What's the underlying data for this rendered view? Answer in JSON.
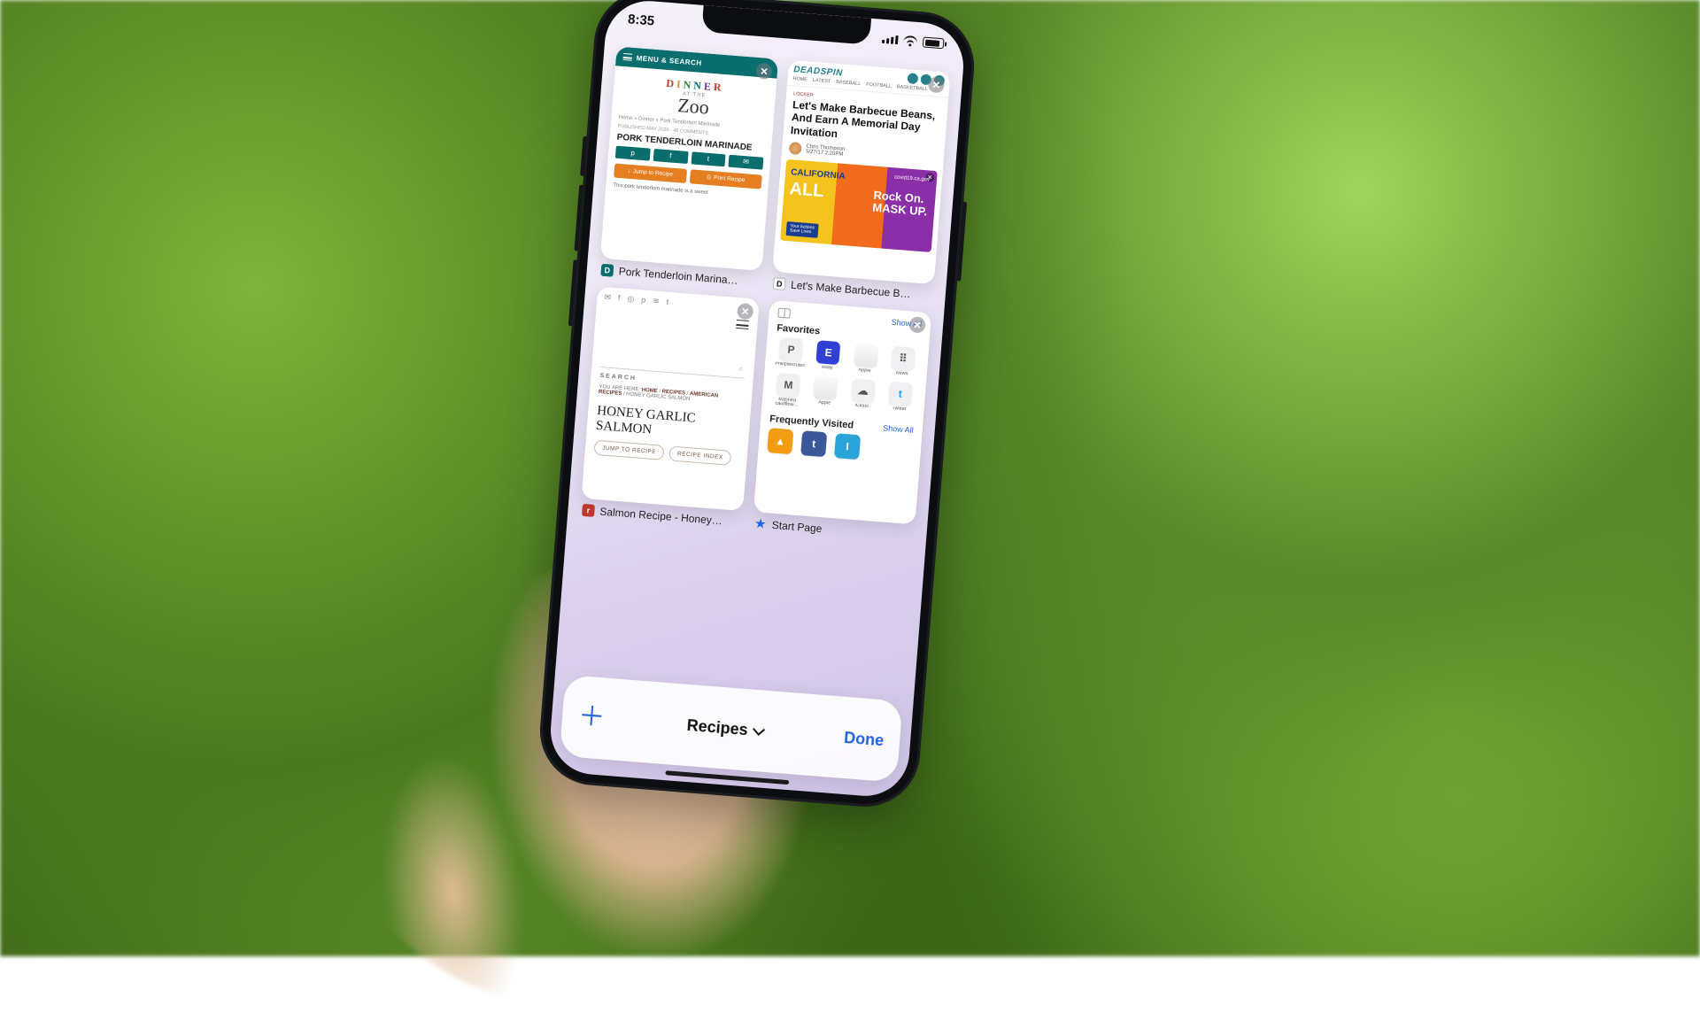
{
  "status_bar": {
    "time": "8:35"
  },
  "tab_group": {
    "name": "Recipes",
    "done_label": "Done"
  },
  "tabs": [
    {
      "label": "Pork Tenderloin Marina…",
      "page": {
        "menu_bar": "MENU & SEARCH",
        "logo_top": "DINNER",
        "logo_mid": "AT THE",
        "logo_bottom": "Zoo",
        "breadcrumb": "Home » Dinner » Pork Tenderloin Marinade",
        "meta": "PUBLISHED MAY 2020 · 46 COMMENTS",
        "title": "PORK TENDERLOIN MARINADE",
        "jump_btn": "Jump to Recipe",
        "print_btn": "Print Recipe",
        "desc": "This pork tenderloin marinade is a sweet"
      }
    },
    {
      "label": "Let's Make Barbecue B…",
      "page": {
        "brand": "DEADSPIN",
        "nav": [
          "HOME",
          "LATEST",
          "BASEBALL",
          "FOOTBALL",
          "BASKETBALL"
        ],
        "section": "LOCKER",
        "title": "Let's Make Barbecue Beans, And Earn A Memorial Day Invitation",
        "byline_name": "Chris Thompson",
        "byline_time": "5/27/17 2:20PM",
        "ad": {
          "california": "CALIFORNIA",
          "all": "ALL",
          "box1": "Your Actions",
          "box2": "Save Lives",
          "covid": "covid19.ca.gov",
          "line1": "Rock On.",
          "line2": "MASK UP."
        }
      }
    },
    {
      "label": "Salmon Recipe - Honey…",
      "page": {
        "search_label": "SEARCH",
        "breadcrumb_pre": "YOU ARE HERE: ",
        "bc_home": "HOME",
        "bc_sep": " / ",
        "bc_recipes": "RECIPES",
        "bc_american": "AMERICAN RECIPES",
        "bc_page": "HONEY GARLIC SALMON",
        "title": "HONEY GARLIC SALMON",
        "jump": "JUMP TO RECIPE",
        "index": "RECIPE INDEX"
      }
    },
    {
      "label": "Start Page",
      "page": {
        "favorites_h": "Favorites",
        "show_all": "Show All",
        "freq_h": "Frequently Visited",
        "fav_items": [
          {
            "icon": "P",
            "label": "PhilipMichaels.com"
          },
          {
            "icon": "E",
            "label": "eBay"
          },
          {
            "icon": "",
            "label": "Apple"
          },
          {
            "icon": "⠿",
            "label": "News"
          },
          {
            "icon": "M",
            "label": "Mashed cauliflow…"
          },
          {
            "icon": "",
            "label": "Apple"
          },
          {
            "icon": "☁︎",
            "label": "iCloud"
          },
          {
            "icon": "t",
            "label": "Twitter"
          }
        ],
        "freq_items": [
          {
            "icon": "▲",
            "bg": "#f39c12"
          },
          {
            "icon": "t",
            "bg": "#3b5998"
          },
          {
            "icon": "I",
            "bg": "#2aa3d8"
          }
        ]
      }
    }
  ]
}
